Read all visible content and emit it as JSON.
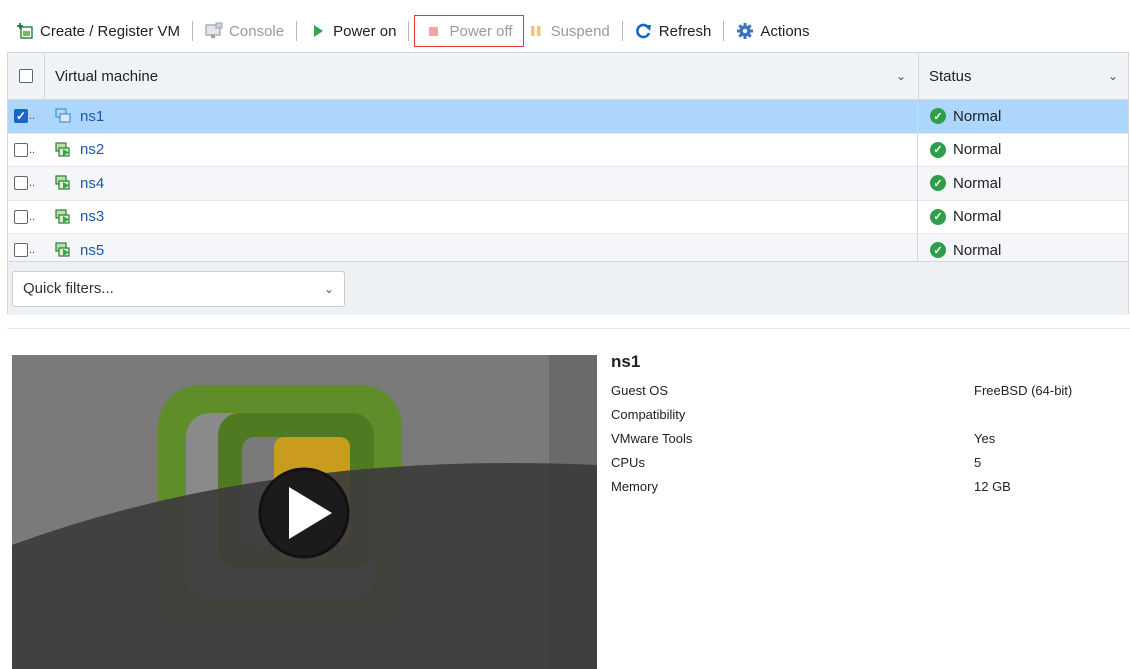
{
  "toolbar": {
    "create": "Create / Register VM",
    "console": "Console",
    "power_on": "Power on",
    "power_off": "Power off",
    "suspend": "Suspend",
    "refresh": "Refresh",
    "actions": "Actions"
  },
  "grid": {
    "col_vm": "Virtual machine",
    "col_status": "Status",
    "rows": [
      {
        "name": "ns1",
        "status": "Normal",
        "selected": true
      },
      {
        "name": "ns2",
        "status": "Normal",
        "selected": false
      },
      {
        "name": "ns4",
        "status": "Normal",
        "selected": false
      },
      {
        "name": "ns3",
        "status": "Normal",
        "selected": false
      },
      {
        "name": "ns5",
        "status": "Normal",
        "selected": false
      }
    ],
    "quick_filters": "Quick filters..."
  },
  "detail": {
    "name": "ns1",
    "fields": [
      {
        "label": "Guest OS",
        "value": "FreeBSD (64-bit)"
      },
      {
        "label": "Compatibility",
        "value": ""
      },
      {
        "label": "VMware Tools",
        "value": "Yes"
      },
      {
        "label": "CPUs",
        "value": "5"
      },
      {
        "label": "Memory",
        "value": "12 GB"
      }
    ]
  },
  "colors": {
    "selected_row": "#acd6fb",
    "link": "#1a5aa8",
    "status_ok": "#2e9e48",
    "power_off_outline": "#e0393e"
  }
}
